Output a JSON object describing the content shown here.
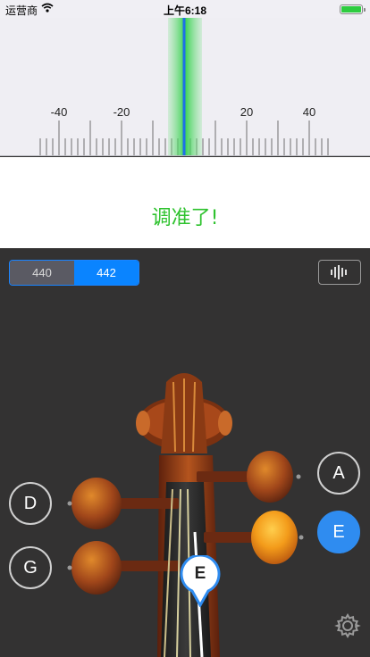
{
  "status_bar": {
    "carrier": "运营商",
    "time": "上午6:18"
  },
  "meter": {
    "tick_labels": [
      "-40",
      "-20",
      "20",
      "40"
    ],
    "indicator_cents": 0
  },
  "status": {
    "message": "调准了!"
  },
  "reference_pitch": {
    "options": [
      "440",
      "442"
    ],
    "selected": "442"
  },
  "strings": {
    "left_top": "D",
    "left_bottom": "G",
    "right_top": "A",
    "right_bottom": "E",
    "selected": "E"
  },
  "marker": {
    "note": "E"
  },
  "colors": {
    "accent": "#0a84ff",
    "tuned": "#2ec22e"
  }
}
